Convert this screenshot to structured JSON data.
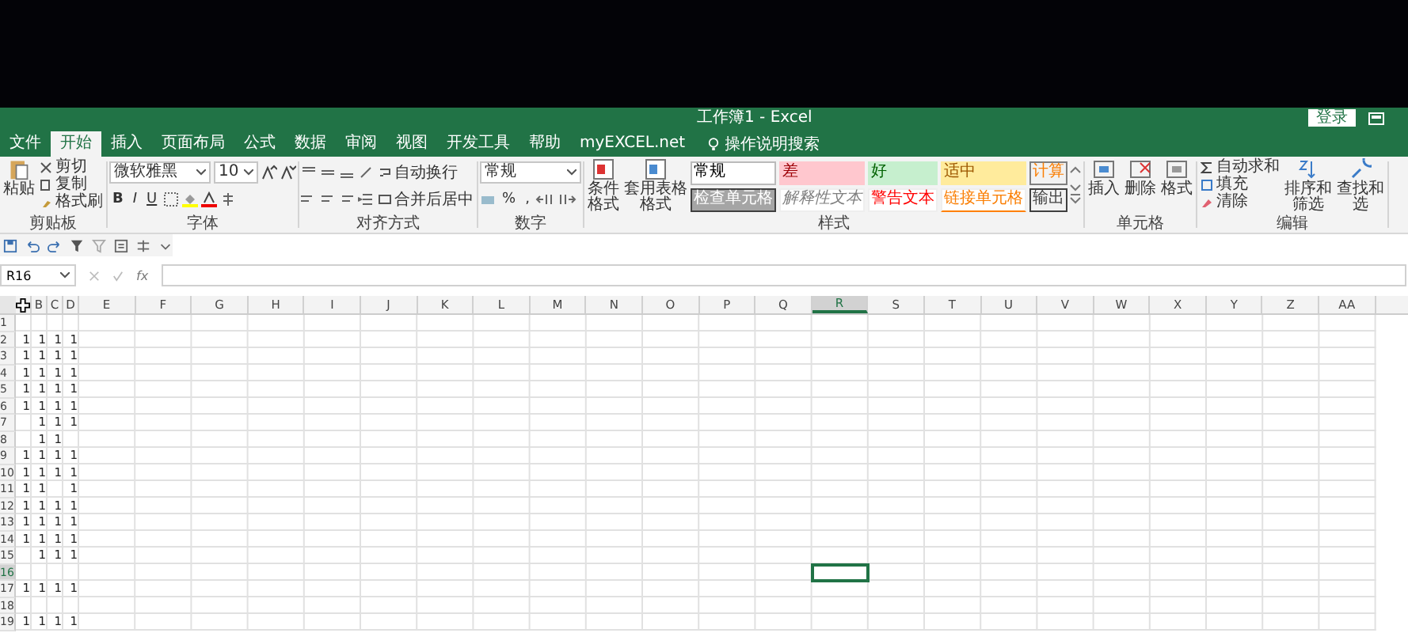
{
  "window": {
    "title": "工作簿1 - Excel",
    "sign_in": "登录"
  },
  "tabs": [
    {
      "label": "文件",
      "selected": false
    },
    {
      "label": "开始",
      "selected": true
    },
    {
      "label": "插入",
      "selected": false
    },
    {
      "label": "页面布局",
      "selected": false
    },
    {
      "label": "公式",
      "selected": false
    },
    {
      "label": "数据",
      "selected": false
    },
    {
      "label": "审阅",
      "selected": false
    },
    {
      "label": "视图",
      "selected": false
    },
    {
      "label": "开发工具",
      "selected": false
    },
    {
      "label": "帮助",
      "selected": false
    },
    {
      "label": "myEXCEL.net",
      "selected": false
    }
  ],
  "tell_me": {
    "placeholder": "操作说明搜索"
  },
  "ribbon": {
    "groups": [
      {
        "kind": "clipboard",
        "label": "剪贴板",
        "big": "粘贴",
        "small": [
          "剪切",
          "复制",
          "格式刷"
        ]
      },
      {
        "kind": "font",
        "label": "字体",
        "font": "微软雅黑",
        "size": "10",
        "format": [
          "B",
          "I",
          "U"
        ]
      },
      {
        "kind": "alignment",
        "label": "对齐方式",
        "wrap": "自动换行",
        "merge": "合并后居中"
      },
      {
        "kind": "number",
        "label": "数字",
        "format": "常规",
        "symbols": [
          "%",
          ","
        ]
      },
      {
        "kind": "styles",
        "label": "样式",
        "big": [
          "条件格式",
          "套用表格格式"
        ],
        "cells": [
          {
            "label": "常规",
            "kind": "normal"
          },
          {
            "label": "差",
            "kind": "bad"
          },
          {
            "label": "好",
            "kind": "good"
          },
          {
            "label": "适中",
            "kind": "neutral"
          },
          {
            "label": "计算",
            "kind": "calculation"
          },
          {
            "label": "检查单元格",
            "kind": "check"
          },
          {
            "label": "解释性文本",
            "kind": "explanatory"
          },
          {
            "label": "警告文本",
            "kind": "warning"
          },
          {
            "label": "链接单元格",
            "kind": "linked"
          },
          {
            "label": "输出",
            "kind": "output"
          }
        ]
      },
      {
        "kind": "cells",
        "label": "单元格",
        "big": [
          "插入",
          "删除",
          "格式"
        ]
      },
      {
        "kind": "editing",
        "label": "编辑",
        "small": [
          "自动求和",
          "填充",
          "清除"
        ],
        "big": [
          "排序和筛选",
          "查找和选"
        ]
      }
    ]
  },
  "formula_bar": {
    "name_box": "R16",
    "function_label": "fx"
  },
  "sheet": {
    "columns": [
      {
        "cursor": true,
        "selected": false
      },
      {
        "label": "B",
        "selected": false
      },
      {
        "label": "C",
        "selected": false
      },
      {
        "label": "D",
        "selected": false
      },
      {
        "label": "E",
        "selected": false
      },
      {
        "label": "F",
        "selected": false
      },
      {
        "label": "G",
        "selected": false
      },
      {
        "label": "H",
        "selected": false
      },
      {
        "label": "I",
        "selected": false
      },
      {
        "label": "J",
        "selected": false
      },
      {
        "label": "K",
        "selected": false
      },
      {
        "label": "L",
        "selected": false
      },
      {
        "label": "M",
        "selected": false
      },
      {
        "label": "N",
        "selected": false
      },
      {
        "label": "O",
        "selected": false
      },
      {
        "label": "P",
        "selected": false
      },
      {
        "label": "Q",
        "selected": false
      },
      {
        "label": "R",
        "selected": true
      },
      {
        "label": "S",
        "selected": false
      },
      {
        "label": "T",
        "selected": false
      },
      {
        "label": "U",
        "selected": false
      },
      {
        "label": "V",
        "selected": false
      },
      {
        "label": "W",
        "selected": false
      },
      {
        "label": "X",
        "selected": false
      },
      {
        "label": "Y",
        "selected": false
      },
      {
        "label": "Z",
        "selected": false
      },
      {
        "label": "AA",
        "selected": false
      }
    ],
    "rows": [
      {
        "label": "1",
        "selected": false,
        "values": {}
      },
      {
        "label": "2",
        "selected": false,
        "values": {
          "0": "1",
          "1": "1",
          "2": "1",
          "3": "1"
        }
      },
      {
        "label": "3",
        "selected": false,
        "values": {
          "0": "1",
          "1": "1",
          "2": "1",
          "3": "1"
        }
      },
      {
        "label": "4",
        "selected": false,
        "values": {
          "0": "1",
          "1": "1",
          "2": "1",
          "3": "1"
        }
      },
      {
        "label": "5",
        "selected": false,
        "values": {
          "0": "1",
          "1": "1",
          "2": "1",
          "3": "1"
        }
      },
      {
        "label": "6",
        "selected": false,
        "values": {
          "0": "1",
          "1": "1",
          "2": "1",
          "3": "1"
        }
      },
      {
        "label": "7",
        "selected": false,
        "values": {
          "1": "1",
          "2": "1",
          "3": "1"
        }
      },
      {
        "label": "8",
        "selected": false,
        "values": {
          "1": "1",
          "2": "1"
        }
      },
      {
        "label": "9",
        "selected": false,
        "values": {
          "0": "1",
          "1": "1",
          "2": "1",
          "3": "1"
        }
      },
      {
        "label": "10",
        "selected": false,
        "values": {
          "0": "1",
          "1": "1",
          "2": "1",
          "3": "1"
        }
      },
      {
        "label": "11",
        "selected": false,
        "values": {
          "0": "1",
          "1": "1",
          "3": "1"
        }
      },
      {
        "label": "12",
        "selected": false,
        "values": {
          "0": "1",
          "1": "1",
          "2": "1",
          "3": "1"
        }
      },
      {
        "label": "13",
        "selected": false,
        "values": {
          "0": "1",
          "1": "1",
          "2": "1",
          "3": "1"
        }
      },
      {
        "label": "14",
        "selected": false,
        "values": {
          "0": "1",
          "1": "1",
          "2": "1",
          "3": "1"
        }
      },
      {
        "label": "15",
        "selected": false,
        "values": {
          "1": "1",
          "2": "1",
          "3": "1"
        }
      },
      {
        "label": "16",
        "selected": true,
        "values": {}
      },
      {
        "label": "17",
        "selected": false,
        "values": {
          "0": "1",
          "1": "1",
          "2": "1",
          "3": "1"
        }
      },
      {
        "label": "18",
        "selected": false,
        "values": {}
      },
      {
        "label": "19",
        "selected": false,
        "values": {
          "0": "1",
          "1": "1",
          "2": "1",
          "3": "1"
        }
      }
    ]
  }
}
